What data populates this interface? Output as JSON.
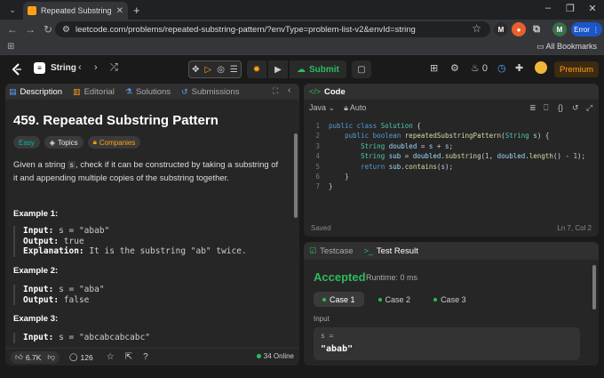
{
  "browser": {
    "tab_title": "Repeated Substring Pattern - Le",
    "url": "leetcode.com/problems/repeated-substring-pattern/?envType=problem-list-v2&envId=string",
    "error_label": "Error",
    "all_bookmarks": "All Bookmarks",
    "ext_m1": "M",
    "ext_m2": "M"
  },
  "nav": {
    "problem_list": "String",
    "submit_label": "Submit",
    "streak_count": "0",
    "premium_label": "Premium"
  },
  "left_panel": {
    "tabs": [
      {
        "label": "Description"
      },
      {
        "label": "Editorial"
      },
      {
        "label": "Solutions"
      },
      {
        "label": "Submissions"
      }
    ],
    "title": "459. Repeated Substring Pattern",
    "tags": {
      "easy": "Easy",
      "topics": "Topics",
      "companies": "Companies"
    },
    "desc_part1": "Given a string ",
    "desc_code": "s",
    "desc_part2": ", check if it can be constructed by taking a substring of it and appending multiple copies of the substring together.",
    "examples": [
      {
        "title": "Example 1:",
        "input": "s = \"abab\"",
        "output": "true",
        "explanation": "It is the substring \"ab\" twice."
      },
      {
        "title": "Example 2:",
        "input": "s = \"aba\"",
        "output": "false"
      },
      {
        "title": "Example 3:",
        "input": "s = \"abcabcabcabc\""
      }
    ],
    "labels": {
      "input": "Input:",
      "output": "Output:",
      "explanation": "Explanation:"
    },
    "footer": {
      "likes": "6.7K",
      "comments": "126",
      "online": "34 Online"
    }
  },
  "code_panel": {
    "title": "Code",
    "language": "Java",
    "mode": "Auto",
    "status_saved": "Saved",
    "cursor_pos": "Ln 7, Col 2",
    "lines": [
      "1",
      "2",
      "3",
      "4",
      "5",
      "6",
      "7"
    ]
  },
  "result_panel": {
    "tab_testcase": "Testcase",
    "tab_result": "Test Result",
    "verdict": "Accepted",
    "runtime": "Runtime: 0 ms",
    "cases": [
      "Case 1",
      "Case 2",
      "Case 3"
    ],
    "input_label": "Input",
    "input_key": "s =",
    "input_value": "\"abab\""
  },
  "colors": {
    "accent": "#ffa116",
    "accepted": "#2cbb5d",
    "error_pill": "#1a56c8"
  }
}
